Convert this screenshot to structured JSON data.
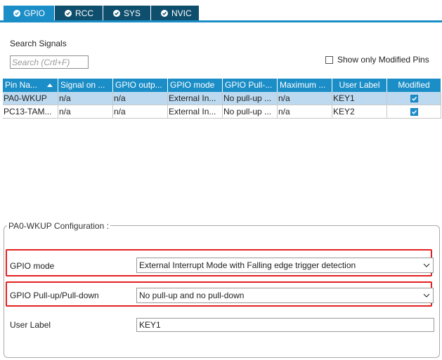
{
  "tabs": [
    {
      "label": "GPIO",
      "active": true
    },
    {
      "label": "RCC",
      "active": false
    },
    {
      "label": "SYS",
      "active": false
    },
    {
      "label": "NVIC",
      "active": false
    }
  ],
  "search": {
    "label": "Search Signals",
    "placeholder": "Search (Crtl+F)",
    "value": ""
  },
  "show_modified": {
    "label": "Show only Modified Pins",
    "checked": false
  },
  "table": {
    "headers": [
      "Pin Na...",
      "Signal on ...",
      "GPIO outp...",
      "GPIO mode",
      "GPIO Pull-...",
      "Maximum ...",
      "User Label",
      "Modified"
    ],
    "rows": [
      {
        "cells": [
          "PA0-WKUP",
          "n/a",
          "n/a",
          "External In...",
          "No pull-up ...",
          "n/a",
          "KEY1"
        ],
        "modified": true,
        "selected": true
      },
      {
        "cells": [
          "PC13-TAM...",
          "n/a",
          "n/a",
          "External In...",
          "No pull-up ...",
          "n/a",
          "KEY2"
        ],
        "modified": true,
        "selected": false
      }
    ]
  },
  "config": {
    "title": "PA0-WKUP Configuration :",
    "gpio_mode_label": "GPIO mode",
    "gpio_mode_value": "External Interrupt Mode with Falling edge trigger detection",
    "pull_label": "GPIO Pull-up/Pull-down",
    "pull_value": "No pull-up and no pull-down",
    "user_label_label": "User Label",
    "user_label_value": "KEY1"
  },
  "colors": {
    "accent": "#1b8ec7",
    "tab_inactive": "#0f4f6e",
    "selected_row": "#bcd9f0",
    "highlight": "#e52020"
  }
}
